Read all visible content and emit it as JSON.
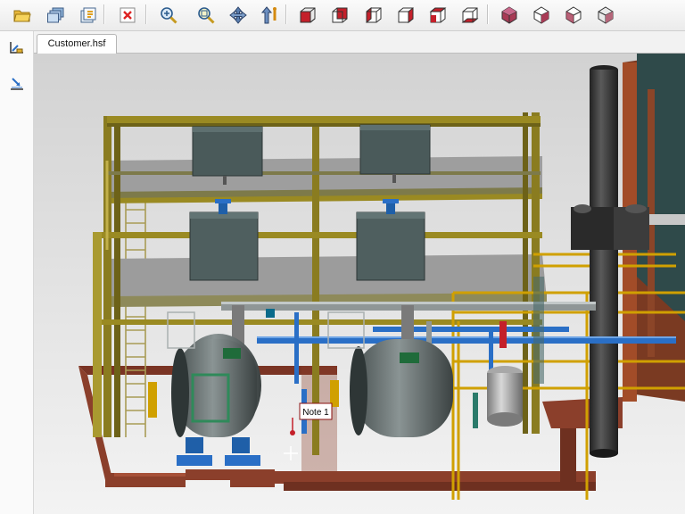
{
  "toolbar": {
    "buttons": [
      {
        "icon": "open-folder-icon"
      },
      {
        "icon": "open-multiple-icon"
      },
      {
        "icon": "properties-icon"
      },
      {
        "icon": "close-file-icon"
      },
      {
        "icon": "zoom-fit-icon"
      },
      {
        "icon": "zoom-window-icon"
      },
      {
        "icon": "pan-icon"
      },
      {
        "icon": "rotate-icon"
      },
      {
        "icon": "view-front-icon"
      },
      {
        "icon": "view-back-icon"
      },
      {
        "icon": "view-left-icon"
      },
      {
        "icon": "view-right-icon"
      },
      {
        "icon": "view-top-icon"
      },
      {
        "icon": "view-bottom-icon"
      },
      {
        "icon": "shaded-mode-icon"
      },
      {
        "icon": "hidden-line-mode-icon"
      },
      {
        "icon": "wireframe-mode-icon"
      },
      {
        "icon": "shaded-edges-mode-icon"
      }
    ]
  },
  "sidebar": {
    "tools": [
      {
        "icon": "measure-tool-icon"
      },
      {
        "icon": "section-tool-icon"
      }
    ]
  },
  "tabs": [
    {
      "label": "Customer.hsf",
      "active": true
    }
  ],
  "viewport": {
    "background_top": "#d2d2d2",
    "background_bottom": "#f2f2f2",
    "annotations": [
      {
        "label": "Note 1"
      }
    ]
  },
  "colors": {
    "steel_frame": "#9a8a22",
    "floor_deck": "#a6a6a6",
    "tank": "#4a5a5a",
    "boiler": "#6e7777",
    "pipe_blue": "#2a6fc6",
    "base_red": "#8b3f2b",
    "stack": "#3c3c3c",
    "rail_yellow": "#d0a000"
  }
}
